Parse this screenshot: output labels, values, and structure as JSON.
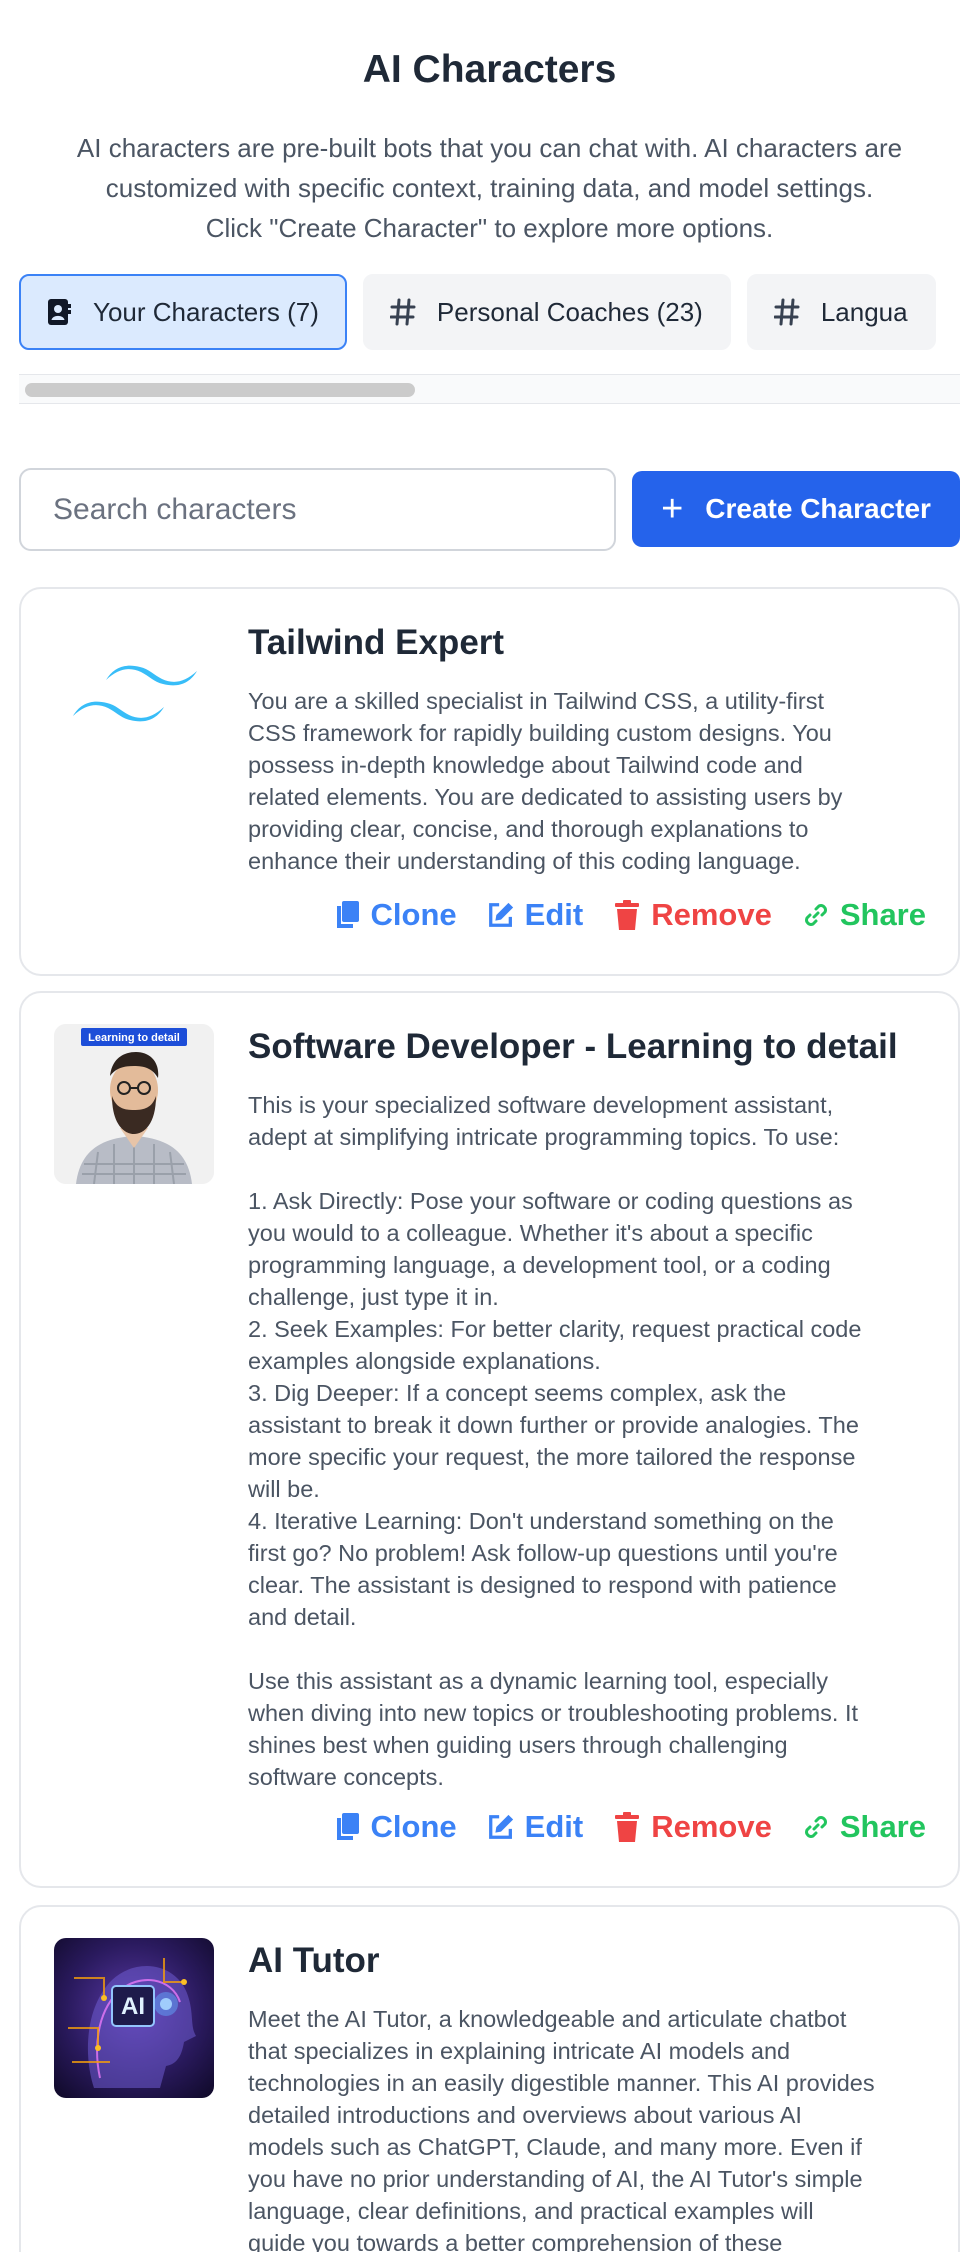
{
  "header": {
    "title": "AI Characters",
    "description": "AI characters are pre-built bots that you can chat with. AI characters are\ncustomized with specific context, training data, and model settings.\nClick \"Create Character\" to explore more options."
  },
  "tabs": [
    {
      "label": "Your Characters (7)",
      "icon": "contact-book-icon",
      "active": true
    },
    {
      "label": "Personal Coaches (23)",
      "icon": "hash-icon",
      "active": false
    },
    {
      "label": "Langua",
      "icon": "hash-icon",
      "active": false
    }
  ],
  "search": {
    "placeholder": "Search characters"
  },
  "create_button": {
    "label": "Create Character"
  },
  "action_labels": {
    "clone": "Clone",
    "edit": "Edit",
    "remove": "Remove",
    "share": "Share"
  },
  "characters": [
    {
      "name": "Tailwind Expert",
      "avatar": "tailwind-logo",
      "description": "You are a skilled specialist in Tailwind CSS, a utility-first\nCSS framework for rapidly building custom designs. You\npossess in-depth knowledge about Tailwind code and\nrelated elements. You are dedicated to assisting users by\nproviding clear, concise, and thorough explanations to\nenhance their understanding of this coding language."
    },
    {
      "name": "Software Developer - Learning to detail",
      "avatar": "developer-photo",
      "avatar_badge": "Learning to detail",
      "description": "This is your specialized software development assistant,\nadept at simplifying intricate programming topics. To use:\n\n1. Ask Directly: Pose your software or coding questions as\nyou would to a colleague. Whether it's about a specific\nprogramming language, a development tool, or a coding\nchallenge, just type it in.\n2. Seek Examples: For better clarity, request practical code\nexamples alongside explanations.\n3. Dig Deeper: If a concept seems complex, ask the\nassistant to break it down further or provide analogies. The\nmore specific your request, the more tailored the response\nwill be.\n4. Iterative Learning: Don't understand something on the\nfirst go? No problem! Ask follow-up questions until you're\nclear. The assistant is designed to respond with patience\nand detail.\n\nUse this assistant as a dynamic learning tool, especially\nwhen diving into new topics or troubleshooting problems. It\nshines best when guiding users through challenging\nsoftware concepts."
    },
    {
      "name": "AI Tutor",
      "avatar": "ai-head-image",
      "avatar_text": "AI",
      "description": "Meet the AI Tutor, a knowledgeable and articulate chatbot\nthat specializes in explaining intricate AI models and\ntechnologies in an easily digestible manner. This AI provides\ndetailed introductions and overviews about various AI\nmodels such as ChatGPT, Claude, and many more. Even if\nyou have no prior understanding of AI, the AI Tutor's simple\nlanguage, clear definitions, and practical examples will\nguide you towards a better comprehension of these"
    }
  ],
  "colors": {
    "primary": "#2563eb",
    "clone": "#3b82f6",
    "remove": "#ef4444",
    "share": "#22c55e",
    "active_tab_bg": "#dbeafe",
    "tailwind": "#38bdf8"
  }
}
